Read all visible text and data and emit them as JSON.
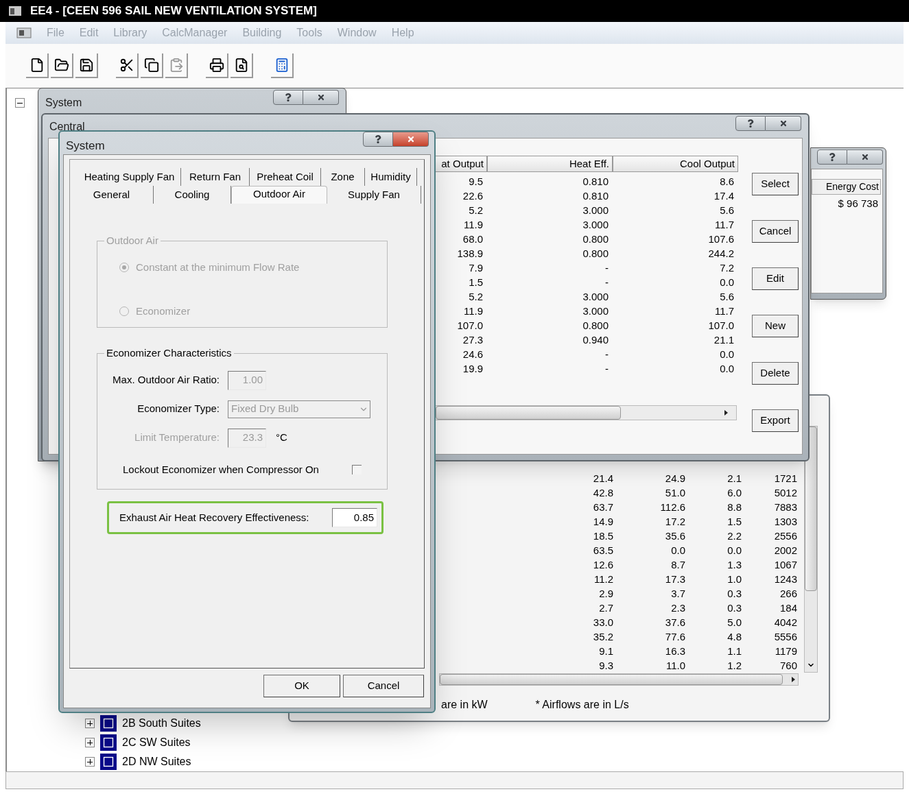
{
  "app": {
    "title": "EE4 - [CEEN 596 SAIL NEW VENTILATION SYSTEM]",
    "menu": [
      {
        "label": "File",
        "disabled": true
      },
      {
        "label": "Edit",
        "disabled": true
      },
      {
        "label": "Library",
        "disabled": true
      },
      {
        "label": "CalcManager",
        "disabled": true
      },
      {
        "label": "Building",
        "disabled": true
      },
      {
        "label": "Tools",
        "disabled": true
      },
      {
        "label": "Window",
        "disabled": true
      },
      {
        "label": "Help",
        "disabled": true
      }
    ]
  },
  "tree": {
    "expanded": true,
    "children": [
      {
        "label": "2B South Suites",
        "expanded": false
      },
      {
        "label": "2C SW Suites",
        "expanded": false
      },
      {
        "label": "2D NW Suites",
        "expanded": false
      }
    ]
  },
  "back_window": {
    "title": "System"
  },
  "energy_window": {
    "column": "Energy Cost",
    "value": "$ 96 738"
  },
  "results_window": {
    "rows": [
      [
        "21.4",
        "24.9",
        "2.1",
        "1721"
      ],
      [
        "42.8",
        "51.0",
        "6.0",
        "5012"
      ],
      [
        "63.7",
        "112.6",
        "8.8",
        "7883"
      ],
      [
        "14.9",
        "17.2",
        "1.5",
        "1303"
      ],
      [
        "18.5",
        "35.6",
        "2.2",
        "2556"
      ],
      [
        "63.5",
        "0.0",
        "0.0",
        "2002"
      ],
      [
        "12.6",
        "8.7",
        "1.3",
        "1067"
      ],
      [
        "11.2",
        "17.3",
        "1.0",
        "1243"
      ],
      [
        "2.9",
        "3.7",
        "0.3",
        "266"
      ],
      [
        "2.7",
        "2.3",
        "0.3",
        "184"
      ],
      [
        "33.0",
        "37.6",
        "5.0",
        "4042"
      ],
      [
        "35.2",
        "77.6",
        "4.8",
        "5556"
      ],
      [
        "9.1",
        "16.3",
        "1.1",
        "1179"
      ],
      [
        "9.3",
        "11.0",
        "1.2",
        "760"
      ]
    ],
    "notes": [
      "are in kW",
      "* Airflows are in L/s"
    ]
  },
  "central_window": {
    "title": "Central",
    "columns": [
      "at Output",
      "Heat Eff.",
      "Cool Output"
    ],
    "rows": [
      [
        "9.5",
        "0.810",
        "8.6"
      ],
      [
        "22.6",
        "0.810",
        "17.4"
      ],
      [
        "5.2",
        "3.000",
        "5.6"
      ],
      [
        "11.9",
        "3.000",
        "11.7"
      ],
      [
        "68.0",
        "0.800",
        "107.6"
      ],
      [
        "138.9",
        "0.800",
        "244.2"
      ],
      [
        "7.9",
        "-",
        "7.2"
      ],
      [
        "1.5",
        "-",
        "0.0"
      ],
      [
        "5.2",
        "3.000",
        "5.6"
      ],
      [
        "11.9",
        "3.000",
        "11.7"
      ],
      [
        "107.0",
        "0.800",
        "107.0"
      ],
      [
        "27.3",
        "0.940",
        "21.1"
      ],
      [
        "24.6",
        "-",
        "0.0"
      ],
      [
        "19.9",
        "-",
        "0.0"
      ]
    ],
    "buttons": [
      "Select",
      "Cancel",
      "Edit",
      "New",
      "Delete",
      "Export"
    ]
  },
  "system_dialog": {
    "title": "System",
    "tab_rows": [
      [
        {
          "label": "Heating Supply Fan",
          "selected": false
        },
        {
          "label": "Return Fan",
          "selected": false
        },
        {
          "label": "Preheat Coil",
          "selected": false
        },
        {
          "label": "Zone",
          "selected": false
        },
        {
          "label": "Humidity",
          "selected": false
        }
      ],
      [
        {
          "label": "General",
          "selected": false
        },
        {
          "label": "Cooling",
          "selected": false
        },
        {
          "label": "Outdoor Air",
          "selected": true
        },
        {
          "label": "Supply Fan",
          "selected": false
        }
      ]
    ],
    "outdoor_air": {
      "title": "Outdoor Air",
      "disabled": true,
      "options": [
        {
          "label": "Constant at the minimum Flow Rate",
          "selected": true
        },
        {
          "label": "Economizer",
          "selected": false
        }
      ]
    },
    "economizer": {
      "title": "Economizer Characteristics",
      "max_ratio": {
        "label": "Max. Outdoor Air Ratio:",
        "value": "1.00",
        "disabled": true
      },
      "type": {
        "label": "Economizer Type:",
        "value": "Fixed Dry Bulb",
        "disabled": true
      },
      "limit_temperature": {
        "label": "Limit Temperature:",
        "value": "23.3",
        "unit": "°C",
        "disabled": true
      },
      "lockout": {
        "label": "Lockout Economizer when Compressor On",
        "checked": false
      }
    },
    "recovery": {
      "label": "Exhaust Air Heat Recovery Effectiveness:",
      "value": "0.85",
      "highlighted": true
    },
    "buttons": [
      "OK",
      "Cancel"
    ]
  }
}
